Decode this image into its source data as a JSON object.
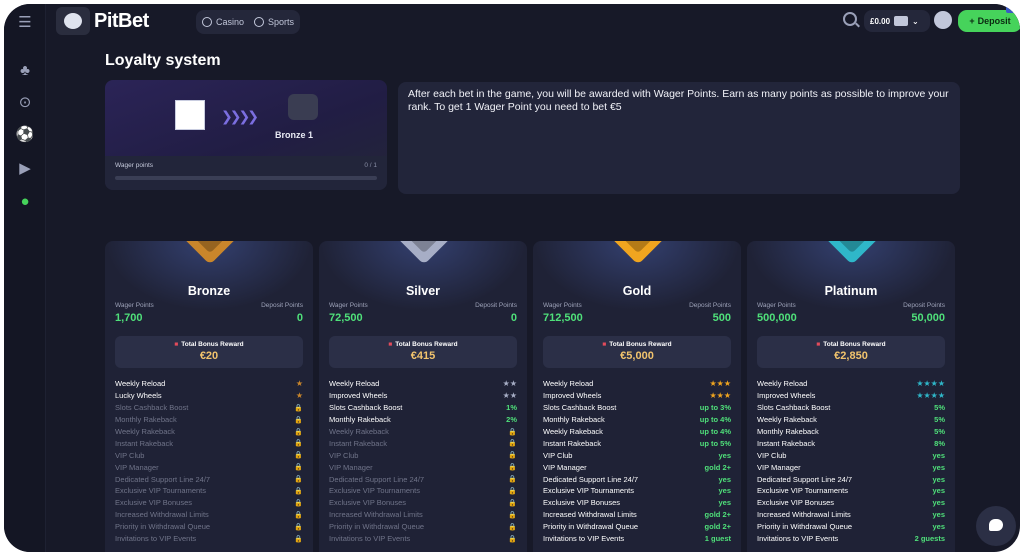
{
  "header": {
    "brand": "PitBet",
    "nav": [
      {
        "label": "Casino"
      },
      {
        "label": "Sports"
      }
    ],
    "balance": "£0.00",
    "deposit_label": "Deposit"
  },
  "page": {
    "title": "Loyalty system",
    "rank": {
      "next_rank": "Bronze 1",
      "wager_label": "Wager points",
      "wager_value": "0 / 1",
      "progress": 0
    },
    "info": "After each bet in the game, you will be awarded with Wager Points. Earn as many points as possible to improve your rank. To get 1 Wager Point you need to bet €5"
  },
  "labels": {
    "wager_points": "Wager Points",
    "deposit_points": "Deposit Points",
    "total_bonus_reward": "Total Bonus Reward"
  },
  "tiers": [
    {
      "name": "Bronze",
      "wager_points": "1,700",
      "deposit_points": "0",
      "reward": "€20",
      "color": "#c9862b",
      "perks": [
        {
          "name": "Weekly Reload",
          "value": "★",
          "locked": false
        },
        {
          "name": "Lucky Wheels",
          "value": "★",
          "locked": false
        },
        {
          "name": "Slots Cashback Boost",
          "value": "🔒",
          "locked": true
        },
        {
          "name": "Monthly Rakeback",
          "value": "🔒",
          "locked": true
        },
        {
          "name": "Weekly Rakeback",
          "value": "🔒",
          "locked": true
        },
        {
          "name": "Instant Rakeback",
          "value": "🔒",
          "locked": true
        },
        {
          "name": "VIP Club",
          "value": "🔒",
          "locked": true
        },
        {
          "name": "VIP Manager",
          "value": "🔒",
          "locked": true
        },
        {
          "name": "Dedicated Support Line 24/7",
          "value": "🔒",
          "locked": true
        },
        {
          "name": "Exclusive VIP Tournaments",
          "value": "🔒",
          "locked": true
        },
        {
          "name": "Exclusive VIP Bonuses",
          "value": "🔒",
          "locked": true
        },
        {
          "name": "Increased Withdrawal Limits",
          "value": "🔒",
          "locked": true
        },
        {
          "name": "Priority in Withdrawal Queue",
          "value": "🔒",
          "locked": true
        },
        {
          "name": "Invitations to VIP Events",
          "value": "🔒",
          "locked": true
        }
      ]
    },
    {
      "name": "Silver",
      "wager_points": "72,500",
      "deposit_points": "0",
      "reward": "€415",
      "color": "#a7aec6",
      "perks": [
        {
          "name": "Weekly Reload",
          "value": "★★",
          "locked": false
        },
        {
          "name": "Improved Wheels",
          "value": "★★",
          "locked": false
        },
        {
          "name": "Slots Cashback Boost",
          "value": "1%",
          "locked": false
        },
        {
          "name": "Monthly Rakeback",
          "value": "2%",
          "locked": false
        },
        {
          "name": "Weekly Rakeback",
          "value": "🔒",
          "locked": true
        },
        {
          "name": "Instant Rakeback",
          "value": "🔒",
          "locked": true
        },
        {
          "name": "VIP Club",
          "value": "🔒",
          "locked": true
        },
        {
          "name": "VIP Manager",
          "value": "🔒",
          "locked": true
        },
        {
          "name": "Dedicated Support Line 24/7",
          "value": "🔒",
          "locked": true
        },
        {
          "name": "Exclusive VIP Tournaments",
          "value": "🔒",
          "locked": true
        },
        {
          "name": "Exclusive VIP Bonuses",
          "value": "🔒",
          "locked": true
        },
        {
          "name": "Increased Withdrawal Limits",
          "value": "🔒",
          "locked": true
        },
        {
          "name": "Priority in Withdrawal Queue",
          "value": "🔒",
          "locked": true
        },
        {
          "name": "Invitations to VIP Events",
          "value": "🔒",
          "locked": true
        }
      ]
    },
    {
      "name": "Gold",
      "wager_points": "712,500",
      "deposit_points": "500",
      "reward": "€5,000",
      "color": "#f0a51f",
      "perks": [
        {
          "name": "Weekly Reload",
          "value": "★★★",
          "locked": false
        },
        {
          "name": "Improved Wheels",
          "value": "★★★",
          "locked": false
        },
        {
          "name": "Slots Cashback Boost",
          "value": "up to 3%",
          "locked": false
        },
        {
          "name": "Monthly Rakeback",
          "value": "up to 4%",
          "locked": false
        },
        {
          "name": "Weekly Rakeback",
          "value": "up to 4%",
          "locked": false
        },
        {
          "name": "Instant Rakeback",
          "value": "up to 5%",
          "locked": false
        },
        {
          "name": "VIP Club",
          "value": "yes",
          "locked": false
        },
        {
          "name": "VIP Manager",
          "value": "gold 2+",
          "locked": false
        },
        {
          "name": "Dedicated Support Line 24/7",
          "value": "yes",
          "locked": false
        },
        {
          "name": "Exclusive VIP Tournaments",
          "value": "yes",
          "locked": false
        },
        {
          "name": "Exclusive VIP Bonuses",
          "value": "yes",
          "locked": false
        },
        {
          "name": "Increased Withdrawal Limits",
          "value": "gold 2+",
          "locked": false
        },
        {
          "name": "Priority in Withdrawal Queue",
          "value": "gold 2+",
          "locked": false
        },
        {
          "name": "Invitations to VIP Events",
          "value": "1 guest",
          "locked": false
        }
      ]
    },
    {
      "name": "Platinum",
      "wager_points": "500,000",
      "deposit_points": "50,000",
      "reward": "€2,850",
      "color": "#2fb7c9",
      "perks": [
        {
          "name": "Weekly Reload",
          "value": "★★★★",
          "locked": false
        },
        {
          "name": "Improved Wheels",
          "value": "★★★★",
          "locked": false
        },
        {
          "name": "Slots Cashback Boost",
          "value": "5%",
          "locked": false
        },
        {
          "name": "Weekly Rakeback",
          "value": "5%",
          "locked": false
        },
        {
          "name": "Monthly Rakeback",
          "value": "5%",
          "locked": false
        },
        {
          "name": "Instant Rakeback",
          "value": "8%",
          "locked": false
        },
        {
          "name": "VIP Club",
          "value": "yes",
          "locked": false
        },
        {
          "name": "VIP Manager",
          "value": "yes",
          "locked": false
        },
        {
          "name": "Dedicated Support Line 24/7",
          "value": "yes",
          "locked": false
        },
        {
          "name": "Exclusive VIP Tournaments",
          "value": "yes",
          "locked": false
        },
        {
          "name": "Exclusive VIP Bonuses",
          "value": "yes",
          "locked": false
        },
        {
          "name": "Increased Withdrawal Limits",
          "value": "yes",
          "locked": false
        },
        {
          "name": "Priority in Withdrawal Queue",
          "value": "yes",
          "locked": false
        },
        {
          "name": "Invitations to VIP Events",
          "value": "2 guests",
          "locked": false
        }
      ]
    }
  ]
}
